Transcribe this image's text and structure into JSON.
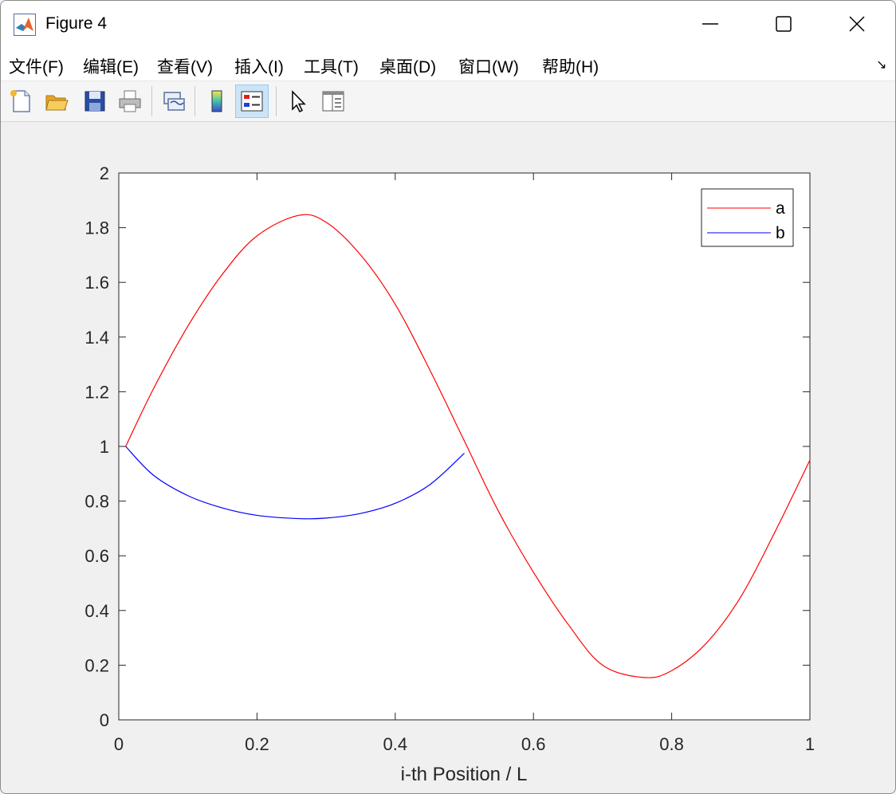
{
  "window": {
    "title": "Figure 4"
  },
  "menu": [
    {
      "label": "文件(F)",
      "name": "menu-file"
    },
    {
      "label": "编辑(E)",
      "name": "menu-edit"
    },
    {
      "label": "查看(V)",
      "name": "menu-view"
    },
    {
      "label": "插入(I)",
      "name": "menu-insert"
    },
    {
      "label": "工具(T)",
      "name": "menu-tools"
    },
    {
      "label": "桌面(D)",
      "name": "menu-desktop"
    },
    {
      "label": "窗口(W)",
      "name": "menu-window"
    },
    {
      "label": "帮助(H)",
      "name": "menu-help"
    }
  ],
  "toolbar": [
    {
      "icon": "new-figure-icon"
    },
    {
      "icon": "open-file-icon"
    },
    {
      "icon": "save-icon"
    },
    {
      "icon": "print-icon"
    },
    {
      "icon": "link-plot-icon"
    },
    {
      "icon": "colorbar-icon"
    },
    {
      "icon": "legend-icon",
      "active": true
    },
    {
      "icon": "pointer-icon"
    },
    {
      "icon": "property-inspector-icon"
    }
  ],
  "colors": {
    "series_a": "#ff0000",
    "series_b": "#0000ff",
    "axes_bg": "#ffffff"
  },
  "chart_data": {
    "type": "line",
    "xlabel": "i-th Position / L",
    "ylabel": "",
    "title": "",
    "xlim": [
      0,
      1
    ],
    "ylim": [
      0,
      2
    ],
    "xticks": [
      "0",
      "0.2",
      "0.4",
      "0.6",
      "0.8",
      "1"
    ],
    "yticks": [
      "0",
      "0.2",
      "0.4",
      "0.6",
      "0.8",
      "1",
      "1.2",
      "1.4",
      "1.6",
      "1.8",
      "2"
    ],
    "legend_position": "top-right",
    "grid": false,
    "series": [
      {
        "name": "a",
        "color": "#ff0000",
        "x": [
          0.01,
          0.05,
          0.1,
          0.15,
          0.2,
          0.26,
          0.3,
          0.35,
          0.4,
          0.45,
          0.5,
          0.55,
          0.6,
          0.65,
          0.7,
          0.76,
          0.8,
          0.85,
          0.9,
          0.95,
          1.0
        ],
        "y": [
          1.0,
          1.21,
          1.44,
          1.63,
          1.77,
          1.845,
          1.82,
          1.7,
          1.52,
          1.28,
          1.02,
          0.76,
          0.54,
          0.35,
          0.2,
          0.155,
          0.18,
          0.28,
          0.45,
          0.69,
          0.95
        ]
      },
      {
        "name": "b",
        "color": "#0000ff",
        "x": [
          0.01,
          0.05,
          0.1,
          0.15,
          0.2,
          0.26,
          0.3,
          0.35,
          0.4,
          0.45,
          0.5
        ],
        "y": [
          1.0,
          0.895,
          0.82,
          0.775,
          0.748,
          0.736,
          0.738,
          0.755,
          0.792,
          0.86,
          0.975
        ]
      }
    ]
  }
}
